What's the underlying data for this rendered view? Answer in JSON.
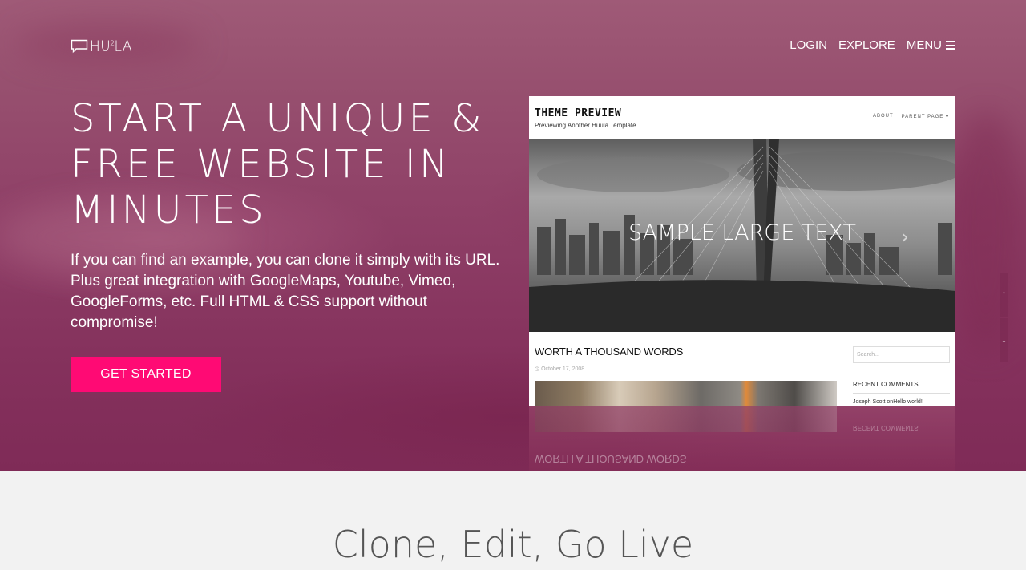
{
  "header": {
    "logo_text": "HU",
    "logo_sup": "2",
    "logo_tail": "LA",
    "nav": {
      "login": "LOGIN",
      "explore": "EXPLORE",
      "menu": "MENU"
    }
  },
  "hero": {
    "headline": "START A UNIQUE & FREE WEBSITE IN MINUTES",
    "lead": "If you can find an example, you can clone it simply with its URL. Plus great integration with GoogleMaps, Youtube, Vimeo, GoogleForms, etc. Full HTML & CSS support without compromise!",
    "cta_label": "GET STARTED",
    "cta_color": "#ff0a74"
  },
  "preview": {
    "site_title": "THEME PREVIEW",
    "site_subtitle": "Previewing Another Huula Template",
    "nav_items": [
      "ABOUT",
      "PARENT PAGE"
    ],
    "banner_text": "SAMPLE LARGE TEXT",
    "post_title": "WORTH A THOUSAND WORDS",
    "post_date": "October 17, 2008",
    "search_placeholder": "Search...",
    "recent_comments_title": "RECENT COMMENTS",
    "recent_comment": "Joseph Scott onHello world!"
  },
  "scroll_controls": {
    "up": "↑",
    "down": "↓"
  },
  "section": {
    "title": "Clone, Edit, Go Live"
  }
}
